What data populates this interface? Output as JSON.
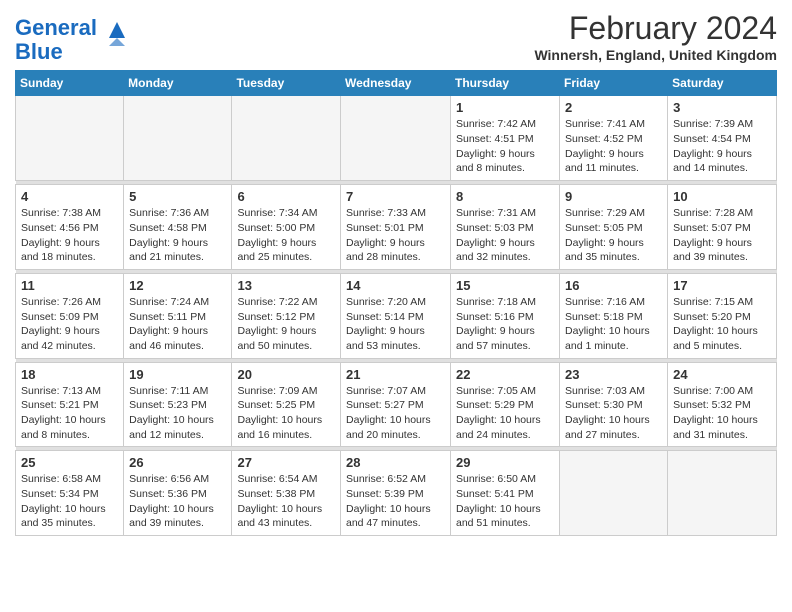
{
  "header": {
    "logo_line1": "General",
    "logo_line2": "Blue",
    "month": "February 2024",
    "location": "Winnersh, England, United Kingdom"
  },
  "weekdays": [
    "Sunday",
    "Monday",
    "Tuesday",
    "Wednesday",
    "Thursday",
    "Friday",
    "Saturday"
  ],
  "weeks": [
    [
      {
        "day": "",
        "info": ""
      },
      {
        "day": "",
        "info": ""
      },
      {
        "day": "",
        "info": ""
      },
      {
        "day": "",
        "info": ""
      },
      {
        "day": "1",
        "info": "Sunrise: 7:42 AM\nSunset: 4:51 PM\nDaylight: 9 hours\nand 8 minutes."
      },
      {
        "day": "2",
        "info": "Sunrise: 7:41 AM\nSunset: 4:52 PM\nDaylight: 9 hours\nand 11 minutes."
      },
      {
        "day": "3",
        "info": "Sunrise: 7:39 AM\nSunset: 4:54 PM\nDaylight: 9 hours\nand 14 minutes."
      }
    ],
    [
      {
        "day": "4",
        "info": "Sunrise: 7:38 AM\nSunset: 4:56 PM\nDaylight: 9 hours\nand 18 minutes."
      },
      {
        "day": "5",
        "info": "Sunrise: 7:36 AM\nSunset: 4:58 PM\nDaylight: 9 hours\nand 21 minutes."
      },
      {
        "day": "6",
        "info": "Sunrise: 7:34 AM\nSunset: 5:00 PM\nDaylight: 9 hours\nand 25 minutes."
      },
      {
        "day": "7",
        "info": "Sunrise: 7:33 AM\nSunset: 5:01 PM\nDaylight: 9 hours\nand 28 minutes."
      },
      {
        "day": "8",
        "info": "Sunrise: 7:31 AM\nSunset: 5:03 PM\nDaylight: 9 hours\nand 32 minutes."
      },
      {
        "day": "9",
        "info": "Sunrise: 7:29 AM\nSunset: 5:05 PM\nDaylight: 9 hours\nand 35 minutes."
      },
      {
        "day": "10",
        "info": "Sunrise: 7:28 AM\nSunset: 5:07 PM\nDaylight: 9 hours\nand 39 minutes."
      }
    ],
    [
      {
        "day": "11",
        "info": "Sunrise: 7:26 AM\nSunset: 5:09 PM\nDaylight: 9 hours\nand 42 minutes."
      },
      {
        "day": "12",
        "info": "Sunrise: 7:24 AM\nSunset: 5:11 PM\nDaylight: 9 hours\nand 46 minutes."
      },
      {
        "day": "13",
        "info": "Sunrise: 7:22 AM\nSunset: 5:12 PM\nDaylight: 9 hours\nand 50 minutes."
      },
      {
        "day": "14",
        "info": "Sunrise: 7:20 AM\nSunset: 5:14 PM\nDaylight: 9 hours\nand 53 minutes."
      },
      {
        "day": "15",
        "info": "Sunrise: 7:18 AM\nSunset: 5:16 PM\nDaylight: 9 hours\nand 57 minutes."
      },
      {
        "day": "16",
        "info": "Sunrise: 7:16 AM\nSunset: 5:18 PM\nDaylight: 10 hours\nand 1 minute."
      },
      {
        "day": "17",
        "info": "Sunrise: 7:15 AM\nSunset: 5:20 PM\nDaylight: 10 hours\nand 5 minutes."
      }
    ],
    [
      {
        "day": "18",
        "info": "Sunrise: 7:13 AM\nSunset: 5:21 PM\nDaylight: 10 hours\nand 8 minutes."
      },
      {
        "day": "19",
        "info": "Sunrise: 7:11 AM\nSunset: 5:23 PM\nDaylight: 10 hours\nand 12 minutes."
      },
      {
        "day": "20",
        "info": "Sunrise: 7:09 AM\nSunset: 5:25 PM\nDaylight: 10 hours\nand 16 minutes."
      },
      {
        "day": "21",
        "info": "Sunrise: 7:07 AM\nSunset: 5:27 PM\nDaylight: 10 hours\nand 20 minutes."
      },
      {
        "day": "22",
        "info": "Sunrise: 7:05 AM\nSunset: 5:29 PM\nDaylight: 10 hours\nand 24 minutes."
      },
      {
        "day": "23",
        "info": "Sunrise: 7:03 AM\nSunset: 5:30 PM\nDaylight: 10 hours\nand 27 minutes."
      },
      {
        "day": "24",
        "info": "Sunrise: 7:00 AM\nSunset: 5:32 PM\nDaylight: 10 hours\nand 31 minutes."
      }
    ],
    [
      {
        "day": "25",
        "info": "Sunrise: 6:58 AM\nSunset: 5:34 PM\nDaylight: 10 hours\nand 35 minutes."
      },
      {
        "day": "26",
        "info": "Sunrise: 6:56 AM\nSunset: 5:36 PM\nDaylight: 10 hours\nand 39 minutes."
      },
      {
        "day": "27",
        "info": "Sunrise: 6:54 AM\nSunset: 5:38 PM\nDaylight: 10 hours\nand 43 minutes."
      },
      {
        "day": "28",
        "info": "Sunrise: 6:52 AM\nSunset: 5:39 PM\nDaylight: 10 hours\nand 47 minutes."
      },
      {
        "day": "29",
        "info": "Sunrise: 6:50 AM\nSunset: 5:41 PM\nDaylight: 10 hours\nand 51 minutes."
      },
      {
        "day": "",
        "info": ""
      },
      {
        "day": "",
        "info": ""
      }
    ]
  ]
}
